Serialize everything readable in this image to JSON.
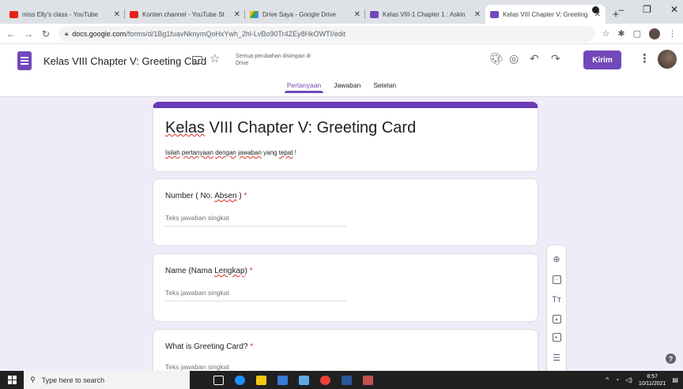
{
  "browser": {
    "tabs": [
      {
        "title": "miss Elly's class - YouTube",
        "favicon": "youtube-icon",
        "active": false
      },
      {
        "title": "Konten channel - YouTube St",
        "favicon": "youtube-icon",
        "active": false
      },
      {
        "title": "Drive Saya - Google Drive",
        "favicon": "google-drive-icon",
        "active": false
      },
      {
        "title": "Kelas VIII-1 Chapter 1 : Askin",
        "favicon": "google-forms-icon",
        "active": false
      },
      {
        "title": "Kelas VIII Chapter V: Greeting",
        "favicon": "google-forms-icon",
        "active": true
      }
    ],
    "url_host": "docs.google.com",
    "url_path": "/forms/d/1Bg1fuavNknymQoHxYwh_2hl-LvBo90Tr4ZEy8HkOWTI/edit"
  },
  "header": {
    "doc_title": "Kelas VIII Chapter V: Greeting Card",
    "save_status": "Semua perubahan disimpan di Drive",
    "send_label": "Kirim",
    "tabs": [
      {
        "label": "Pertanyaan",
        "active": true
      },
      {
        "label": "Jawaban",
        "active": false
      },
      {
        "label": "Setelan",
        "active": false
      }
    ],
    "accent_color": "#7248b9"
  },
  "form": {
    "title": "Kelas VIII Chapter V: Greeting Card",
    "description_parts": [
      "Isilah",
      " ",
      "pertanyaan",
      " ",
      "dengan",
      " ",
      "jawaban",
      " yang ",
      "tepat",
      " !"
    ],
    "questions": [
      {
        "label_start": "Number ( No. ",
        "label_underlined": "Absen",
        "label_end": " )",
        "required_mark": "*",
        "answer_placeholder": "Teks jawaban singkat"
      },
      {
        "label_start": "Name (Nama ",
        "label_underlined": "Lengkap",
        "label_end": ")",
        "required_mark": "*",
        "answer_placeholder": "Teks jawaban singkat"
      },
      {
        "label_start": "What is Greeting Card?",
        "label_underlined": "",
        "label_end": "",
        "required_mark": "*",
        "answer_placeholder": "Teks jawaban singkat"
      }
    ]
  },
  "toolbar_text_icon": "Tт",
  "taskbar": {
    "search_placeholder": "Type here to search",
    "time": "8:57",
    "date": "10/11/2021"
  }
}
